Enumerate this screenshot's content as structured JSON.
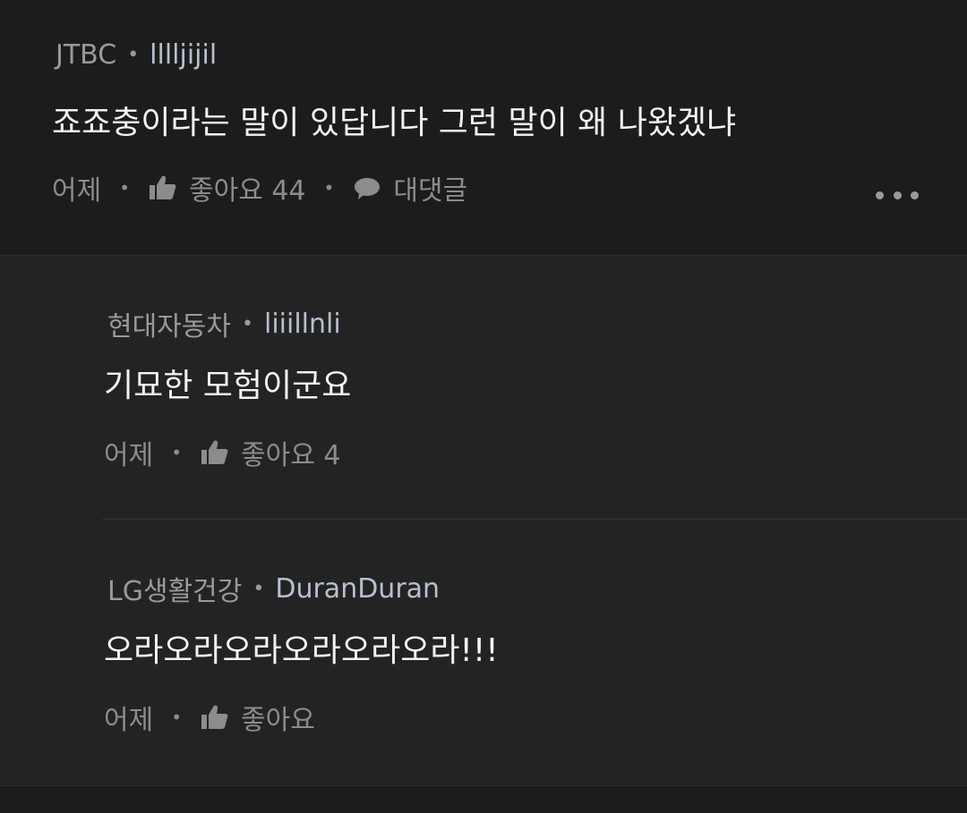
{
  "comments": [
    {
      "company": "JTBC",
      "nickname": "lllljijil",
      "text": "죠죠충이라는 말이 있답니다 그런 말이 왜 나왔겠냐",
      "time": "어제",
      "like_label": "좋아요 44",
      "reply_label": "대댓글",
      "more_icon": "more-horizontal-icon"
    }
  ],
  "replies": [
    {
      "company": "현대자동차",
      "nickname": "liiillnli",
      "text": "기묘한 모험이군요",
      "time": "어제",
      "like_label": "좋아요 4"
    },
    {
      "company": "LG생활건강",
      "nickname": "DuranDuran",
      "text": "오라오라오라오라오라오라!!!",
      "time": "어제",
      "like_label": "좋아요"
    }
  ],
  "separator": "•",
  "colors": {
    "background": "#1c1c1c",
    "reply_background": "#232323",
    "text": "#f2f2f2",
    "meta": "#8c8c8c",
    "nickname": "#b7bfd0"
  }
}
